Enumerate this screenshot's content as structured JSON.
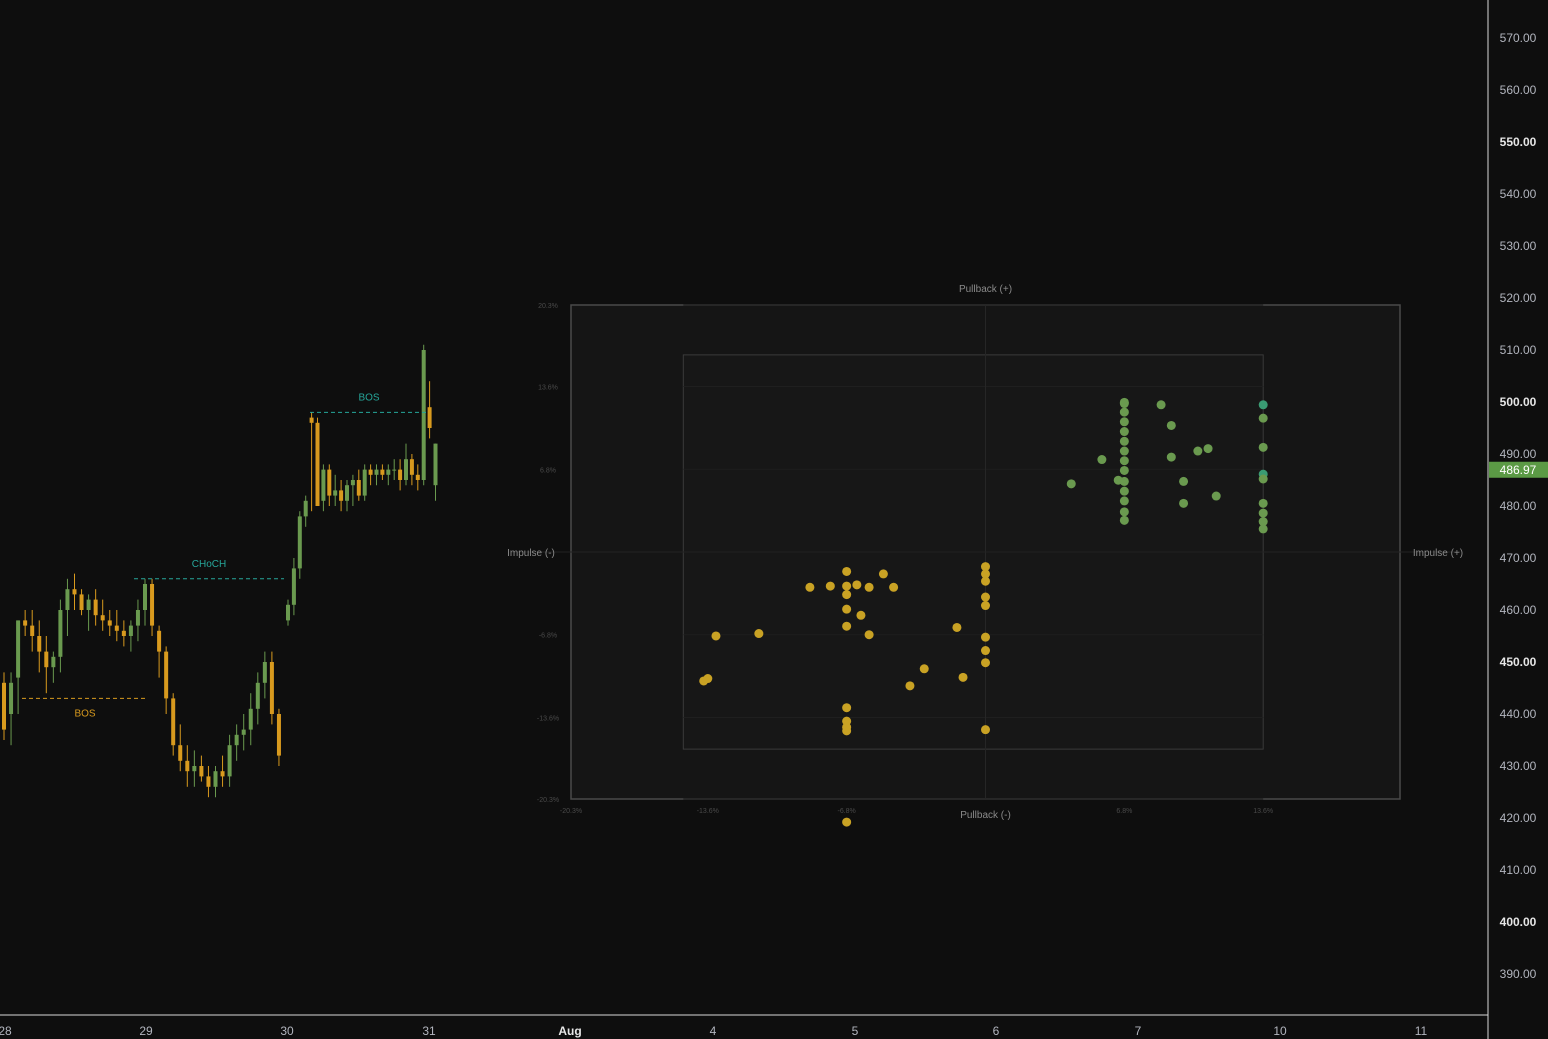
{
  "theme": {
    "background": "#0e0e0e",
    "text": "#b2b5be",
    "bull_color": "#6a9a4f",
    "bear_color": "#d89a1e",
    "bos_bear_color": "#d89a1e",
    "bos_bull_color": "#26a69a",
    "choch_color": "#26a69a",
    "price_badge_color": "#5b9a45"
  },
  "chart_data": [
    {
      "type": "candlestick",
      "title": "",
      "x_axis": {
        "labels": [
          "28",
          "29",
          "30",
          "31",
          "Aug",
          "4",
          "5",
          "6",
          "7",
          "10",
          "11"
        ],
        "bold": [
          "Aug"
        ]
      },
      "y_axis": {
        "ylim": [
          385,
          575
        ],
        "ticks": [
          570,
          560,
          550,
          540,
          530,
          520,
          510,
          500,
          490,
          480,
          470,
          460,
          450,
          440,
          430,
          420,
          410,
          400,
          390
        ],
        "tick_labels": [
          "570.00",
          "560.00",
          "550.00",
          "540.00",
          "530.00",
          "520.00",
          "510.00",
          "500.00",
          "490.00",
          "480.00",
          "470.00",
          "460.00",
          "450.00",
          "440.00",
          "430.00",
          "420.00",
          "410.00",
          "400.00",
          "390.00"
        ],
        "bold_ticks": [
          "550.00",
          "500.00",
          "450.00",
          "400.00"
        ],
        "last_price": 486.97,
        "last_price_label": "486.97"
      },
      "candles_ohlc": [
        [
          446,
          448,
          435,
          437
        ],
        [
          440,
          448,
          434,
          446
        ],
        [
          447,
          458,
          440,
          458
        ],
        [
          458,
          460,
          455,
          457
        ],
        [
          457,
          460,
          452,
          455
        ],
        [
          455,
          458,
          448,
          452
        ],
        [
          452,
          455,
          444,
          449
        ],
        [
          449,
          452,
          446,
          451
        ],
        [
          451,
          462,
          448,
          460
        ],
        [
          460,
          466,
          455,
          464
        ],
        [
          464,
          467,
          460,
          463
        ],
        [
          463,
          464,
          459,
          460
        ],
        [
          460,
          463,
          456,
          462
        ],
        [
          462,
          464,
          457,
          459
        ],
        [
          459,
          462,
          456,
          458
        ],
        [
          458,
          460,
          455,
          457
        ],
        [
          457,
          460,
          454,
          456
        ],
        [
          456,
          458,
          453,
          455
        ],
        [
          455,
          458,
          452,
          457
        ],
        [
          457,
          462,
          454,
          460
        ],
        [
          460,
          466,
          457,
          465
        ],
        [
          465,
          466,
          455,
          457
        ],
        [
          456,
          457,
          447,
          452
        ],
        [
          452,
          453,
          440,
          443
        ],
        [
          443,
          444,
          432,
          434
        ],
        [
          434,
          438,
          429,
          431
        ],
        [
          431,
          434,
          426,
          429
        ],
        [
          429,
          433,
          426,
          430
        ],
        [
          430,
          432,
          427,
          428
        ],
        [
          428,
          430,
          424,
          426
        ],
        [
          426,
          430,
          424,
          429
        ],
        [
          429,
          432,
          426,
          428
        ],
        [
          428,
          436,
          426,
          434
        ],
        [
          434,
          438,
          431,
          436
        ],
        [
          436,
          440,
          433,
          437
        ],
        [
          437,
          444,
          434,
          441
        ],
        [
          441,
          448,
          438,
          446
        ],
        [
          446,
          452,
          443,
          450
        ],
        [
          450,
          452,
          438,
          440
        ],
        [
          440,
          441,
          430,
          432
        ],
        [
          458,
          462,
          457,
          461
        ],
        [
          461,
          470,
          459,
          468
        ],
        [
          468,
          479,
          466,
          478
        ],
        [
          478,
          482,
          476,
          481
        ],
        [
          497,
          498,
          479,
          496
        ],
        [
          496,
          497,
          480,
          480
        ],
        [
          481,
          488,
          479,
          487
        ],
        [
          487,
          488,
          480,
          482
        ],
        [
          482,
          486,
          480,
          483
        ],
        [
          483,
          485,
          479,
          481
        ],
        [
          481,
          485,
          479,
          484
        ],
        [
          484,
          486,
          480,
          485
        ],
        [
          485,
          487,
          481,
          482
        ],
        [
          482,
          488,
          481,
          487
        ],
        [
          487,
          488,
          484,
          486
        ],
        [
          486,
          488,
          484,
          487
        ],
        [
          487,
          488,
          485,
          486
        ],
        [
          486,
          488,
          484,
          487
        ],
        [
          487,
          489,
          485,
          487
        ],
        [
          487,
          489,
          483,
          485
        ],
        [
          485,
          492,
          484,
          489
        ],
        [
          489,
          490,
          484,
          486
        ],
        [
          486,
          488,
          483,
          485
        ],
        [
          485,
          511,
          484,
          510
        ],
        [
          499,
          504,
          493,
          495
        ],
        [
          484,
          492,
          481,
          492
        ]
      ],
      "structure_labels": [
        {
          "text": "BOS",
          "level": 443,
          "kind": "bearish"
        },
        {
          "text": "CHoCH",
          "level": 466,
          "kind": "bullish"
        },
        {
          "text": "BOS",
          "level": 498,
          "kind": "bullish"
        }
      ]
    },
    {
      "type": "scatter",
      "title": "",
      "quadrant_labels": {
        "top": "Pullback (+)",
        "bottom": "Pullback (-)",
        "left": "Impulse (-)",
        "right": "Impulse (+)"
      },
      "y_tick_labels": [
        "20.3%",
        "13.6%",
        "6.8%",
        "-6.8%",
        "-13.6%",
        "-20.3%"
      ],
      "y_tick_values": [
        20.3,
        13.6,
        6.8,
        -6.8,
        -13.6,
        -20.3
      ],
      "x_tick_labels": [
        "-20.3%",
        "-13.6%",
        "-6.8%",
        "6.8%",
        "13.6%"
      ],
      "x_tick_values": [
        -20.3,
        -13.6,
        -6.8,
        6.8,
        13.6
      ],
      "xlim": [
        -20.3,
        20.3
      ],
      "ylim": [
        -20.3,
        20.3
      ],
      "inner_box": {
        "x": [
          -14.8,
          13.6
        ],
        "y": [
          -16.2,
          16.2
        ]
      },
      "points": [
        [
          -13.8,
          -10.6,
          "y"
        ],
        [
          -13.6,
          -10.4,
          "y"
        ],
        [
          -13.2,
          -6.9,
          "y"
        ],
        [
          -11.1,
          -6.7,
          "y"
        ],
        [
          -8.6,
          -2.9,
          "y"
        ],
        [
          -7.6,
          -2.8,
          "y"
        ],
        [
          -6.8,
          -1.6,
          "y"
        ],
        [
          -6.8,
          -2.8,
          "y"
        ],
        [
          -6.8,
          -3.5,
          "y"
        ],
        [
          -6.8,
          -4.7,
          "y"
        ],
        [
          -6.8,
          -6.1,
          "y"
        ],
        [
          -6.3,
          -2.7,
          "y"
        ],
        [
          -6.1,
          -5.2,
          "y"
        ],
        [
          -5.7,
          -2.9,
          "y"
        ],
        [
          -5.7,
          -6.8,
          "y"
        ],
        [
          -5.0,
          -1.8,
          "y"
        ],
        [
          -4.5,
          -2.9,
          "y"
        ],
        [
          -6.8,
          -12.8,
          "y"
        ],
        [
          -6.8,
          -13.9,
          "y"
        ],
        [
          -6.8,
          -14.4,
          "y"
        ],
        [
          -6.8,
          -14.7,
          "y"
        ],
        [
          -6.8,
          -22.2,
          "y"
        ],
        [
          -3.7,
          -11.0,
          "y"
        ],
        [
          -3.0,
          -9.6,
          "y"
        ],
        [
          -1.4,
          -6.2,
          "y"
        ],
        [
          -1.1,
          -10.3,
          "y"
        ],
        [
          0,
          -1.2,
          "y"
        ],
        [
          0,
          -1.8,
          "y"
        ],
        [
          0,
          -2.4,
          "y"
        ],
        [
          0,
          -3.7,
          "y"
        ],
        [
          0,
          -4.4,
          "y"
        ],
        [
          0,
          -7.0,
          "y"
        ],
        [
          0,
          -8.1,
          "y"
        ],
        [
          0,
          -9.1,
          "y"
        ],
        [
          0,
          -14.6,
          "y"
        ],
        [
          4.2,
          5.6,
          "g"
        ],
        [
          5.7,
          7.6,
          "g"
        ],
        [
          6.5,
          5.9,
          "g"
        ],
        [
          6.8,
          4.2,
          "g"
        ],
        [
          6.8,
          5.0,
          "g"
        ],
        [
          6.8,
          5.8,
          "g"
        ],
        [
          6.8,
          6.7,
          "g"
        ],
        [
          6.8,
          7.5,
          "g"
        ],
        [
          6.8,
          8.3,
          "g"
        ],
        [
          6.8,
          9.1,
          "g"
        ],
        [
          6.8,
          9.9,
          "g"
        ],
        [
          6.8,
          10.7,
          "g"
        ],
        [
          6.8,
          11.5,
          "g"
        ],
        [
          6.8,
          12.3,
          "g"
        ],
        [
          6.8,
          3.3,
          "g"
        ],
        [
          6.8,
          2.6,
          "g"
        ],
        [
          6.8,
          12.2,
          "g"
        ],
        [
          8.6,
          12.1,
          "g"
        ],
        [
          9.1,
          10.4,
          "g"
        ],
        [
          9.1,
          7.8,
          "g"
        ],
        [
          9.7,
          5.8,
          "g"
        ],
        [
          9.7,
          4.0,
          "g"
        ],
        [
          10.4,
          8.3,
          "g"
        ],
        [
          10.9,
          8.5,
          "g"
        ],
        [
          11.3,
          4.6,
          "g"
        ],
        [
          13.6,
          12.1,
          "t"
        ],
        [
          13.6,
          11.0,
          "g"
        ],
        [
          13.6,
          8.6,
          "g"
        ],
        [
          13.6,
          6.4,
          "t"
        ],
        [
          13.6,
          6.0,
          "g"
        ],
        [
          13.6,
          4.0,
          "g"
        ],
        [
          13.6,
          3.2,
          "g"
        ],
        [
          13.6,
          2.5,
          "g"
        ],
        [
          13.6,
          1.9,
          "g"
        ]
      ],
      "point_colors": {
        "y": "#c9a224",
        "g": "#6a9a4f",
        "t": "#3a9b73"
      }
    }
  ]
}
